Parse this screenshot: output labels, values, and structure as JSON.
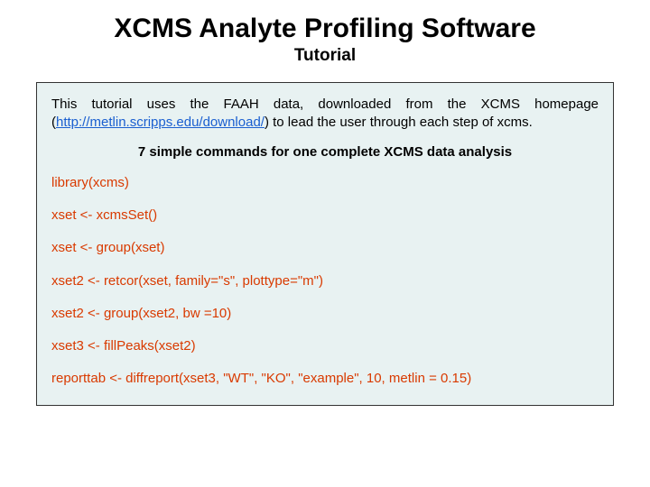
{
  "title": "XCMS Analyte Profiling Software",
  "subtitle": "Tutorial",
  "intro_prefix": "This tutorial uses the FAAH data, downloaded from the XCMS homepage (",
  "intro_link": "http://metlin.scripps.edu/download/",
  "intro_suffix": ") to lead the user through each step of xcms.",
  "section_head": "7 simple commands for one complete XCMS data analysis",
  "commands": [
    "library(xcms)",
    "xset <- xcmsSet()",
    "xset <- group(xset)",
    "xset2 <- retcor(xset, family=\"s\", plottype=\"m\")",
    "xset2 <- group(xset2, bw =10)",
    "xset3 <- fillPeaks(xset2)",
    "reporttab <- diffreport(xset3, \"WT\", \"KO\", \"example\", 10, metlin = 0.15)"
  ]
}
